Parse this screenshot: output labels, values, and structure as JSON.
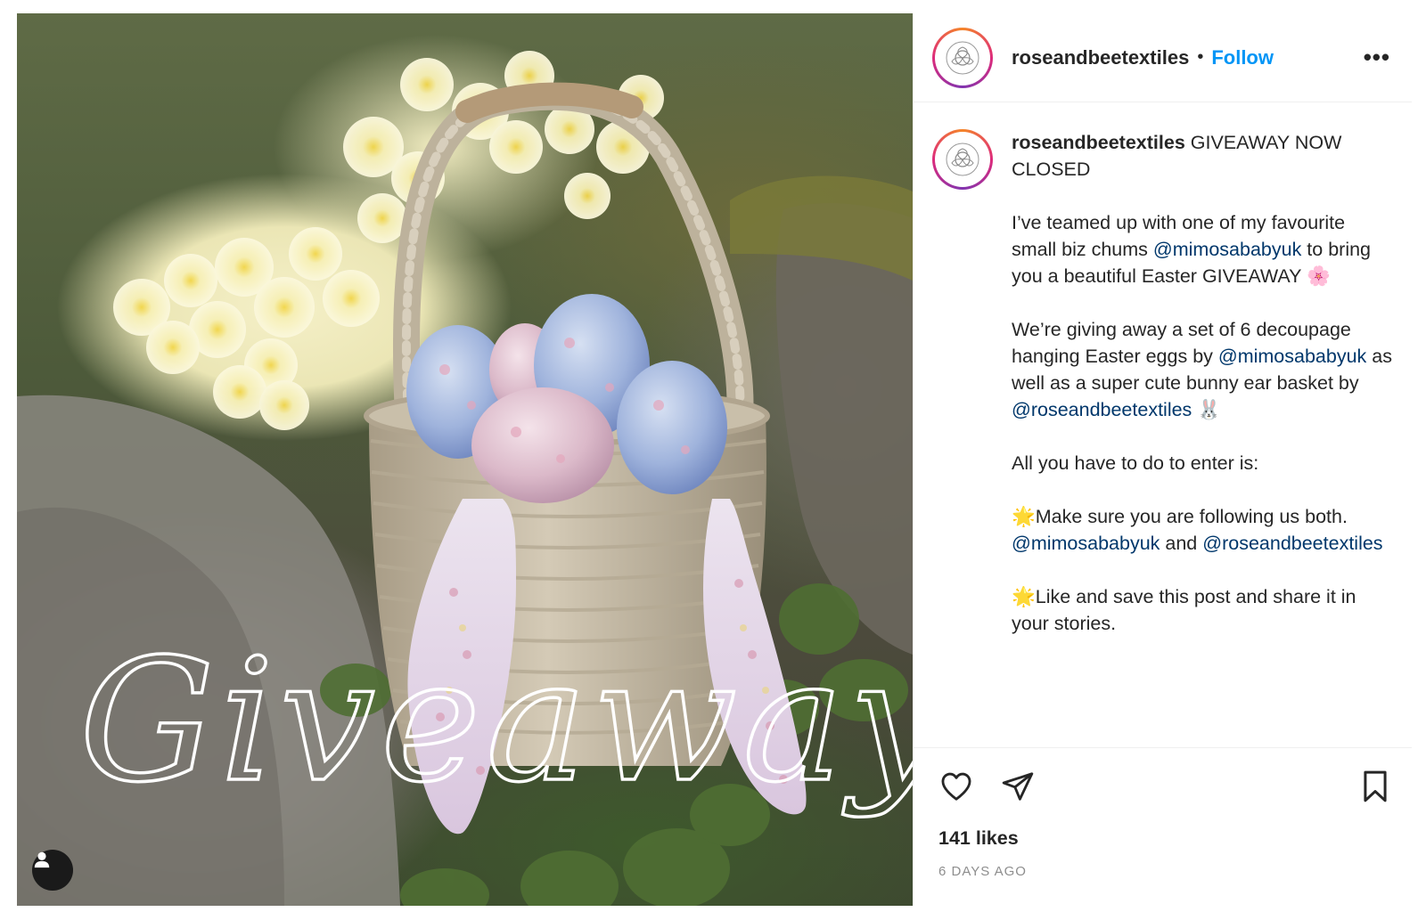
{
  "post": {
    "username": "roseandbeetextiles",
    "separator": "•",
    "follow_label": "Follow",
    "more_label": "•••",
    "image_overlay_text": "Giveaway",
    "caption": {
      "headline": "GIVEAWAY NOW CLOSED",
      "p1_a": "I’ve teamed up with one of my favourite small biz chums ",
      "p1_mention": "@mimosababyuk",
      "p1_b": " to bring you a beautiful Easter GIVEAWAY 🌸",
      "p2_a": "We’re giving away a set of 6 decoupage hanging Easter eggs by ",
      "p2_mention1": "@mimosababyuk",
      "p2_b": " as well as a super cute bunny ear basket by ",
      "p2_mention2": "@roseandbeetextiles",
      "p2_c": " 🐰",
      "p3": "All you have to do to enter is:",
      "p4_a": "🌟Make sure you are following us both. ",
      "p4_mention1": "@mimosababyuk",
      "p4_b": " and ",
      "p4_mention2": "@roseandbeetextiles",
      "p5": "🌟Like and save this post and share it in your stories."
    },
    "likes": "141 likes",
    "time": "6 DAYS AGO"
  },
  "icons": {
    "like": "heart-icon",
    "share": "paper-plane-icon",
    "save": "bookmark-icon",
    "tagged_user": "user-icon"
  },
  "colors": {
    "follow": "#0095f6",
    "mention": "#00376b",
    "muted": "#8e8e8e"
  }
}
